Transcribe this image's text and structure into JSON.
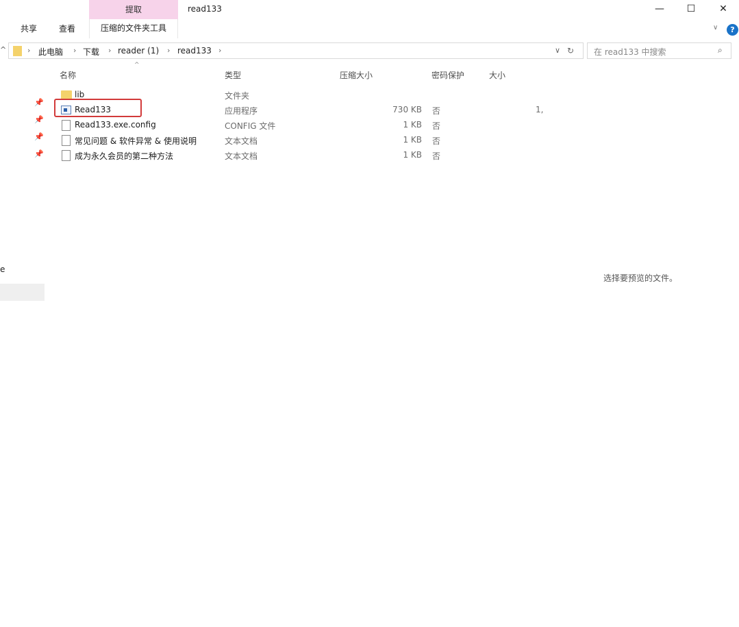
{
  "window": {
    "title": "read133",
    "context_tab": "提取",
    "controls": {
      "minimize": "—",
      "maximize": "☐",
      "close": "✕"
    }
  },
  "ribbon": {
    "tabs": [
      "共享",
      "查看"
    ],
    "active_tab": "压缩的文件夹工具",
    "help_label": "?"
  },
  "address": {
    "breadcrumbs": [
      "此电脑",
      "下载",
      "reader (1)",
      "read133"
    ],
    "search_placeholder": "在 read133 中搜索"
  },
  "columns": {
    "name": "名称",
    "type": "类型",
    "compressed_size": "压缩大小",
    "password_protected": "密码保护",
    "size": "大小"
  },
  "files": [
    {
      "name": "lib",
      "type": "文件夹",
      "compressed_size": "",
      "password_protected": "",
      "size": "",
      "icon": "folder-icon"
    },
    {
      "name": "Read133",
      "type": "应用程序",
      "compressed_size": "730 KB",
      "password_protected": "否",
      "size": "1,",
      "icon": "application-icon"
    },
    {
      "name": "Read133.exe.config",
      "type": "CONFIG 文件",
      "compressed_size": "1 KB",
      "password_protected": "否",
      "size": "",
      "icon": "file-icon"
    },
    {
      "name": "常见问题 & 软件异常 & 使用说明",
      "type": "文本文档",
      "compressed_size": "1 KB",
      "password_protected": "否",
      "size": "",
      "icon": "text-file-icon"
    },
    {
      "name": "成为永久会员的第二种方法",
      "type": "文本文档",
      "compressed_size": "1 KB",
      "password_protected": "否",
      "size": "",
      "icon": "text-file-icon"
    }
  ],
  "preview_message": "选择要预览的文件。",
  "left_edge_fragments": [
    "e"
  ],
  "colors": {
    "context_tab": "#f7d3ea",
    "highlight_border": "#d23a3a",
    "folder": "#f4d26b",
    "help": "#1a73c8"
  }
}
